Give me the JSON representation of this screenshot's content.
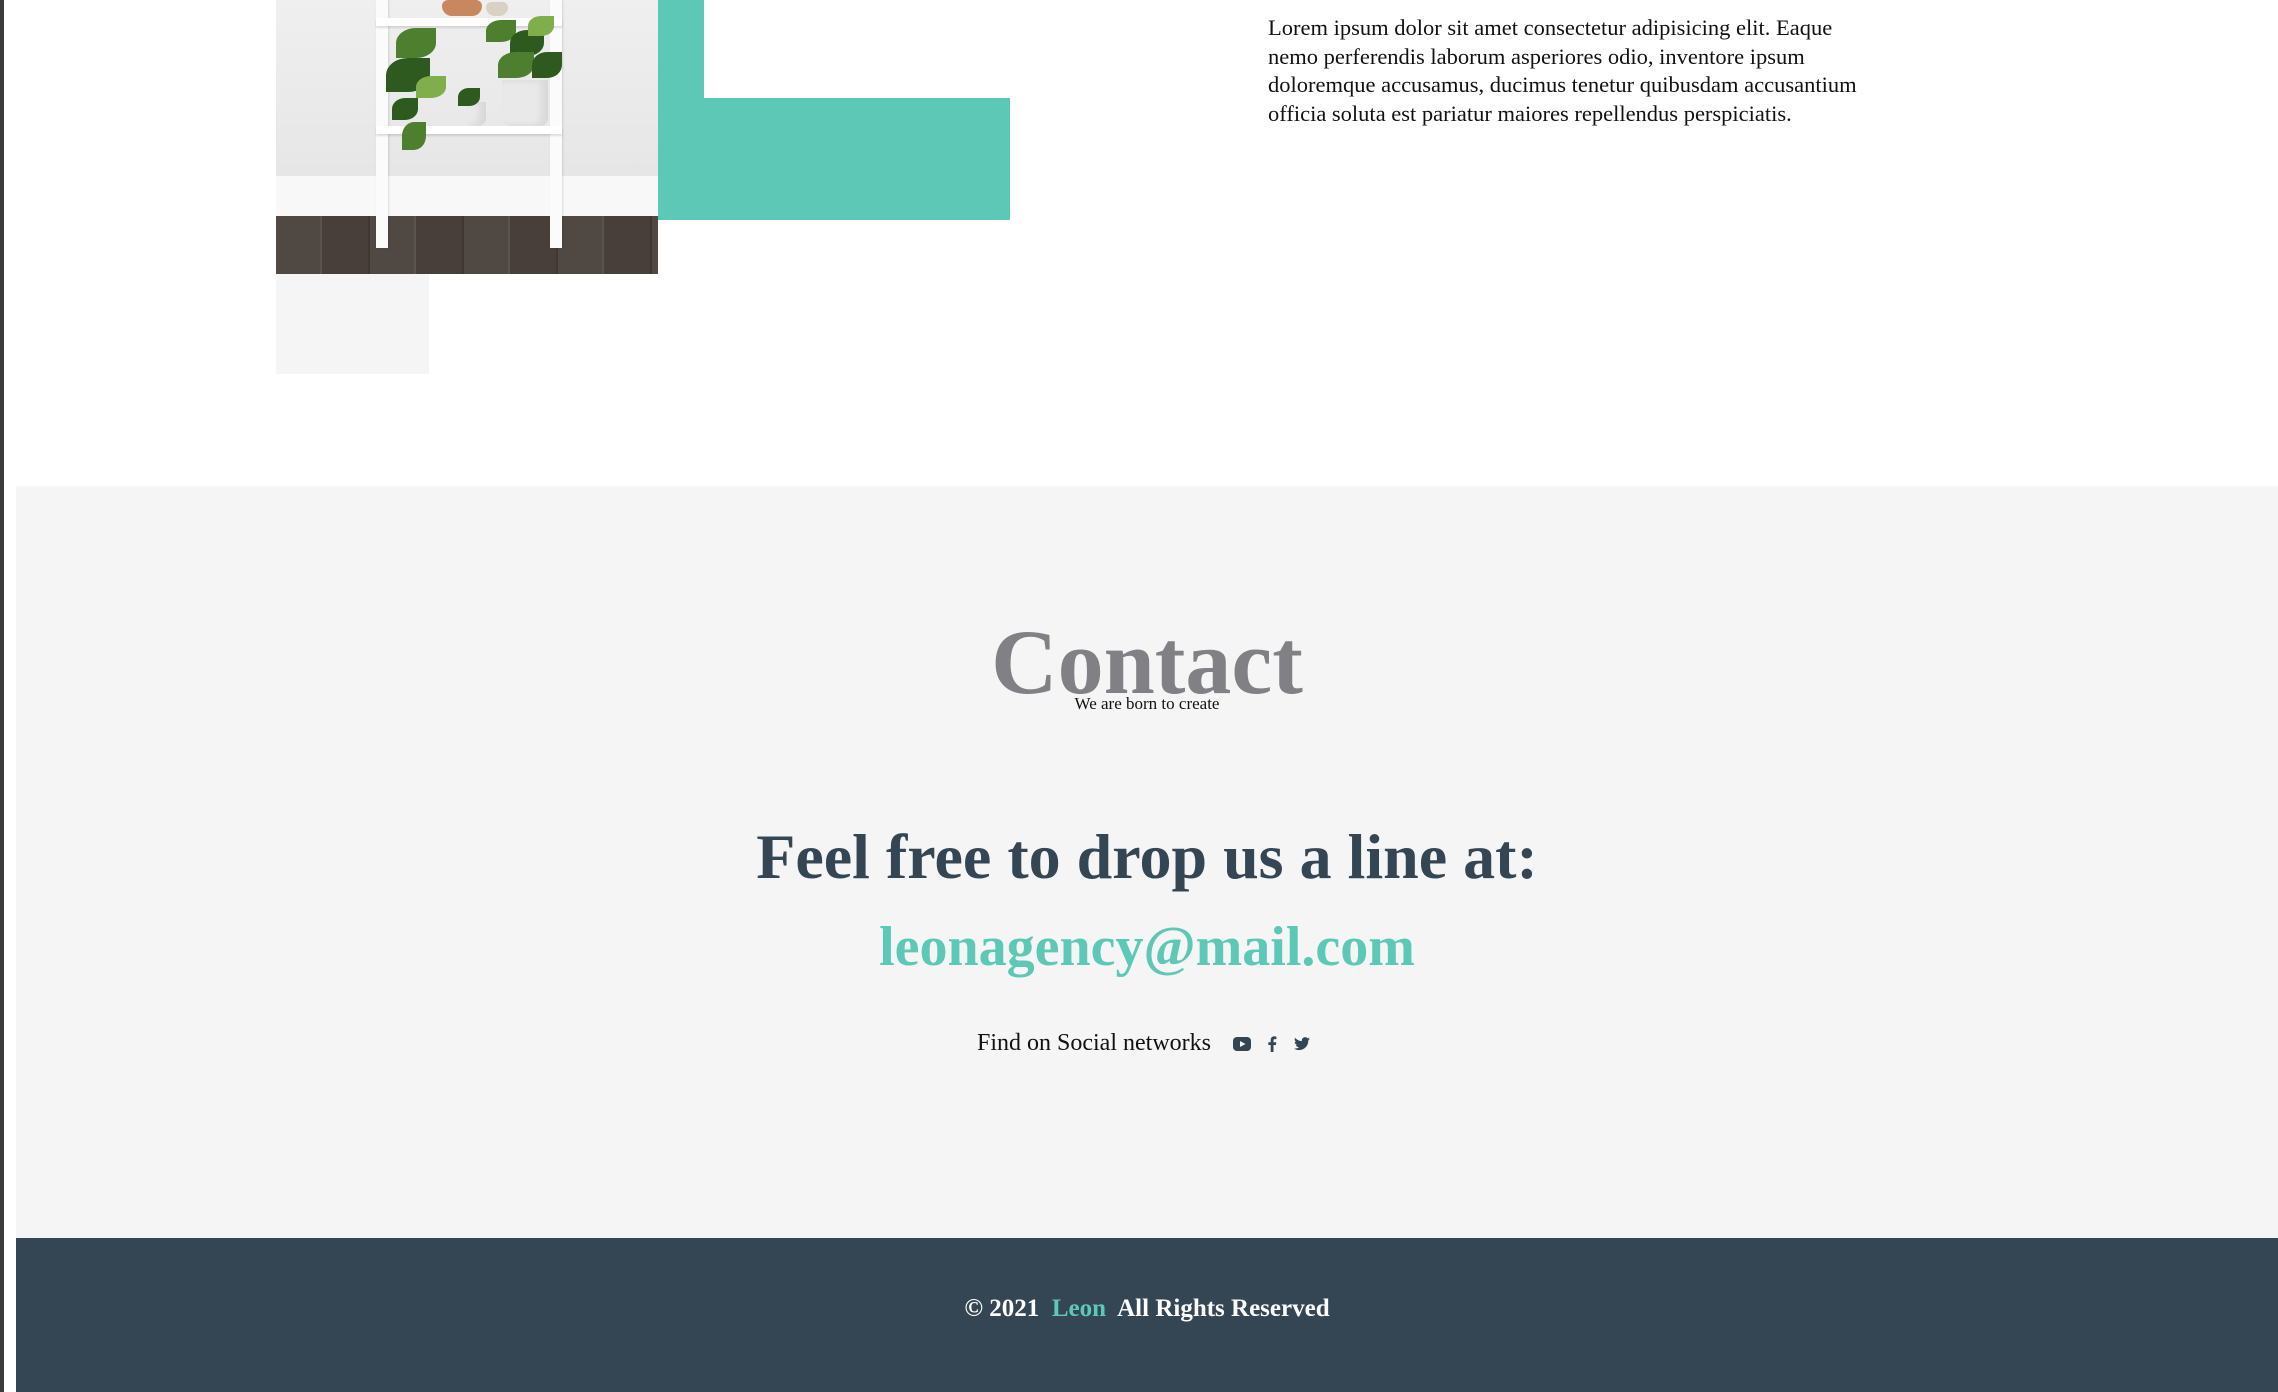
{
  "colors": {
    "accent": "#5ec8b6",
    "dark": "#344654",
    "title_grey": "#818185",
    "section_bg": "#f5f5f5"
  },
  "about": {
    "paragraph": "Lorem ipsum dolor sit amet consectetur adipisicing elit. Eaque nemo perferendis laborum asperiores odio, inventore ipsum doloremque accusamus, ducimus tenetur quibusdam accusantium officia soluta est pariatur maiores repellendus perspiciatis."
  },
  "contact": {
    "title": "Contact",
    "subtitle": "We are born to create",
    "lead": "Feel free to drop us a line at:",
    "email": "leonagency@mail.com",
    "social_label": "Find on Social networks",
    "social_icons": [
      "youtube-icon",
      "facebook-icon",
      "twitter-icon"
    ]
  },
  "footer": {
    "prefix": "© 2021",
    "brand": "Leon",
    "suffix": "All Rights Reserved"
  }
}
